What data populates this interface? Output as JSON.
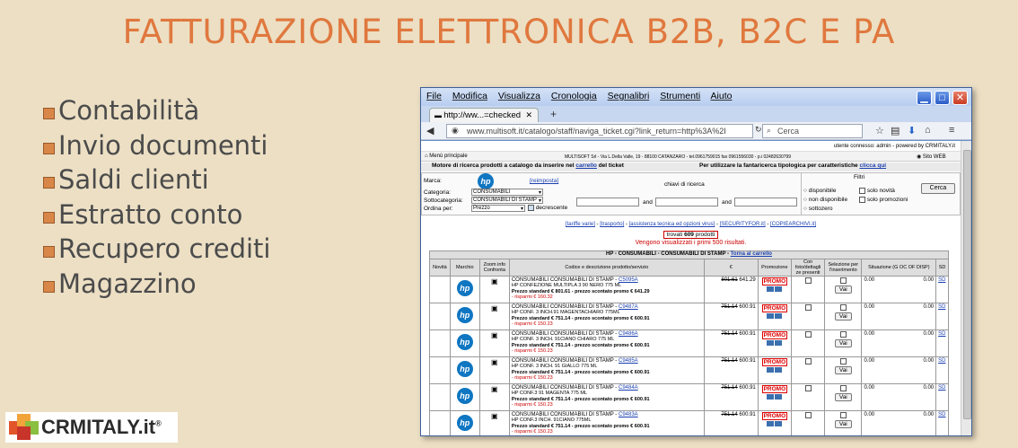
{
  "slide": {
    "title": "FATTURAZIONE ELETTRONICA B2B, B2C E PA",
    "bullets": [
      "Contabilità",
      "Invio documenti",
      "Saldi clienti",
      "Estratto conto",
      "Recupero crediti",
      "Magazzino"
    ]
  },
  "logo": {
    "text": "CRMITALY.it",
    "reg": "®"
  },
  "browser": {
    "menu": [
      "File",
      "Modifica",
      "Visualizza",
      "Cronologia",
      "Segnalibri",
      "Strumenti",
      "Aiuto"
    ],
    "tab_label": "http://ww...=checked",
    "url": "www.multisoft.it/catalogo/staff/naviga_ticket.cgi?link_return=http%3A%2I",
    "search_placeholder": "Cerca"
  },
  "page": {
    "user_line": "utente connesso: admin - powered by CRMITALY.it",
    "menu_principale": "Menù principale",
    "company_line": "MULTISOFT Srl - Via L.Della Valle, 19 - 88100 CATANZARO - tel.0961759015 fax 0961556030 - p.i 02482630799",
    "sito_web": "Sito WEB",
    "headline_a": "Motore di ricerca prodotti a catalogo da inserire nel",
    "headline_carrello": "carrello",
    "headline_b": "del ticket",
    "headline_c": "Per utilizzare la fantaricerca tipologica per caratteristiche",
    "headline_clicca": "clicca qui",
    "marca_label": "Marca:",
    "reimposta": "[reimposta]",
    "chiavi": "chiavi di ricerca",
    "filtri": "Filtri",
    "categoria_label": "Categoria:",
    "categoria_value": "CONSUMABILI",
    "sottocategoria_label": "Sottocategoria:",
    "sottocategoria_value": "CONSUMABILI DI STAMP",
    "ordina_label": "Ordina per:",
    "ordina_value": "Prezzo",
    "decrescente": "decrescente",
    "and1": "and",
    "and2": "and",
    "f_disponibile": "disponibile",
    "f_non_disponibile": "non disponibile",
    "f_sottozero": "sottozero",
    "f_novita": "solo novità",
    "f_promozioni": "solo promozioni",
    "cerca_btn": "Cerca",
    "links": [
      "[tariffe varie]",
      "[trasporto]",
      "[assistenza tecnica ed opzioni virus]",
      "[SECURITYFOR.it]",
      "[COPIEARCHIVI.it]"
    ],
    "trovati_a": "trovati ",
    "trovati_n": "609",
    "trovati_b": " prodotti",
    "visualizzati": "Vengono visualizzati i primi 500 risultati.",
    "group_title": "HP - CONSUMABILI - CONSUMABILI DI STAMP - ",
    "torna": "Torna al carrello",
    "headers": [
      "Novità",
      "Marchio",
      "Zoom info Confronta",
      "Codice e descrizione prodotto/servizio",
      "€",
      "Promozione",
      "Con foto/dettagli ze presenti",
      "Selezione per l'inserimento",
      "Situazione (G OC OF DISP)",
      "SD"
    ],
    "vai": "Vai",
    "promo": "PROMO",
    "rows": [
      {
        "cat": "CONSUMABILI CONSUMABILI DI STAMP - ",
        "code": "C5095A",
        "desc": "HP CONFEZIONE MULTIPLA 3 90 NERO 775 ML",
        "std": "Prezzo standard € 801.61 - prezzo scontato promo € 641.29",
        "save": "- risparmi € 160.32",
        "old": "801.61",
        "new": "641.29",
        "s1": "0.00",
        "s2": "0.00",
        "sd": "SD"
      },
      {
        "cat": "CONSUMABILI CONSUMABILI DI STAMP - ",
        "code": "C9487A",
        "desc": "HP CONF. 3 INCH.91 MAGENTACHIARO 775ML",
        "std": "Prezzo standard € 751.14 - prezzo scontato promo € 600.91",
        "save": "- risparmi € 150.23",
        "old": "751.14",
        "new": "600.91",
        "s1": "0.00",
        "s2": "0.00",
        "sd": "SD"
      },
      {
        "cat": "CONSUMABILI CONSUMABILI DI STAMP - ",
        "code": "C9486A",
        "desc": "HP CONF. 3 INCH. 91CIANO CHIARO 775 ML",
        "std": "Prezzo standard € 751.14 - prezzo scontato promo € 600.91",
        "save": "- risparmi € 150.23",
        "old": "751.14",
        "new": "600.91",
        "s1": "0.00",
        "s2": "0.00",
        "sd": "SD"
      },
      {
        "cat": "CONSUMABILI CONSUMABILI DI STAMP - ",
        "code": "C9485A",
        "desc": "HP CONF. 3 INCH. 91 GIALLO 775 ML",
        "std": "Prezzo standard € 751.14 - prezzo scontato promo € 600.91",
        "save": "- risparmi € 150.23",
        "old": "751.14",
        "new": "600.91",
        "s1": "0.00",
        "s2": "0.00",
        "sd": "SD"
      },
      {
        "cat": "CONSUMABILI CONSUMABILI DI STAMP - ",
        "code": "C9484A",
        "desc": "HP CONF.3 91 MAGENTA 775 ML",
        "std": "Prezzo standard € 751.14 - prezzo scontato promo € 600.91",
        "save": "- risparmi € 150.23",
        "old": "751.14",
        "new": "600.91",
        "s1": "0.00",
        "s2": "0.00",
        "sd": "SD"
      },
      {
        "cat": "CONSUMABILI CONSUMABILI DI STAMP - ",
        "code": "C9483A",
        "desc": "HP CONF.3 INCH. 91CIANO 775ML",
        "std": "Prezzo standard € 751.14 - prezzo scontato promo € 600.91",
        "save": "- risparmi € 150.23",
        "old": "751.14",
        "new": "600.91",
        "s1": "0.00",
        "s2": "0.00",
        "sd": "SD"
      }
    ]
  },
  "colors": {
    "title": "#e0783e",
    "background": "#ecdfc4",
    "promo": "#dd0000",
    "hp": "#0f76c2"
  }
}
